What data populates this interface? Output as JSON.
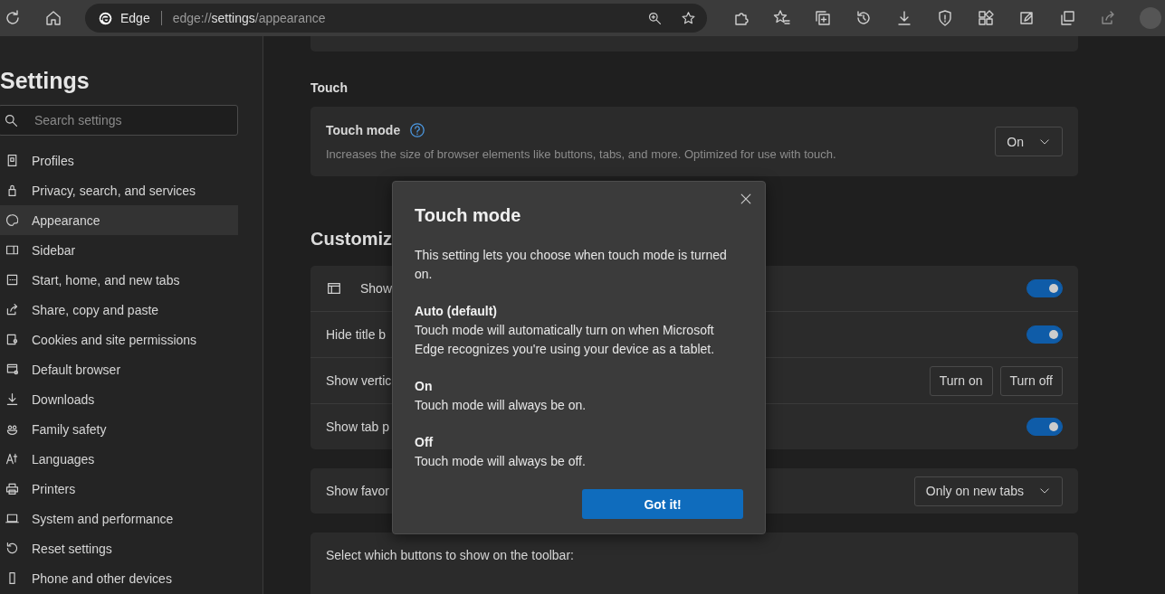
{
  "browser": {
    "tab_label": "Edge",
    "url": [
      {
        "text": "edge://",
        "bright": false
      },
      {
        "text": "settings",
        "bright": true
      },
      {
        "text": "/appearance",
        "bright": false
      }
    ]
  },
  "sidebar": {
    "title": "Settings",
    "search": {
      "placeholder": "Search settings"
    },
    "items": [
      {
        "label": "Profiles",
        "selected": false
      },
      {
        "label": "Privacy, search, and services",
        "selected": false
      },
      {
        "label": "Appearance",
        "selected": true
      },
      {
        "label": "Sidebar",
        "selected": false
      },
      {
        "label": "Start, home, and new tabs",
        "selected": false
      },
      {
        "label": "Share, copy and paste",
        "selected": false
      },
      {
        "label": "Cookies and site permissions",
        "selected": false
      },
      {
        "label": "Default browser",
        "selected": false
      },
      {
        "label": "Downloads",
        "selected": false
      },
      {
        "label": "Family safety",
        "selected": false
      },
      {
        "label": "Languages",
        "selected": false
      },
      {
        "label": "Printers",
        "selected": false
      },
      {
        "label": "System and performance",
        "selected": false
      },
      {
        "label": "Reset settings",
        "selected": false
      },
      {
        "label": "Phone and other devices",
        "selected": false
      }
    ]
  },
  "touch_section": {
    "heading": "Touch",
    "title": "Touch mode",
    "description": "Increases the size of browser elements like buttons, tabs, and more. Optimized for use with touch.",
    "dropdown": "On"
  },
  "customize_section": {
    "heading": "Customiz",
    "rows": [
      {
        "kind": "toggle",
        "label": "Show",
        "icon": true,
        "on": true
      },
      {
        "kind": "toggle",
        "label": "Hide title b",
        "on": true
      },
      {
        "kind": "buttons",
        "label": "Show vertic",
        "buttons": [
          "Turn on",
          "Turn off"
        ]
      },
      {
        "kind": "toggle",
        "label": "Show tab p",
        "on": true
      }
    ]
  },
  "favorites_row": {
    "label": "Show favor",
    "dropdown": "Only on new tabs"
  },
  "toolbar_section": {
    "label": "Select which buttons to show on the toolbar:"
  },
  "dialog": {
    "title": "Touch mode",
    "intro": "This setting lets you choose when touch mode is turned on.",
    "options": [
      {
        "name": "Auto (default)",
        "text": "Touch mode will automatically turn on when Microsoft Edge recognizes you're using your device as a tablet."
      },
      {
        "name": "On",
        "text": "Touch mode will always be on."
      },
      {
        "name": "Off",
        "text": "Touch mode will always be off."
      }
    ],
    "button": "Got it!"
  }
}
